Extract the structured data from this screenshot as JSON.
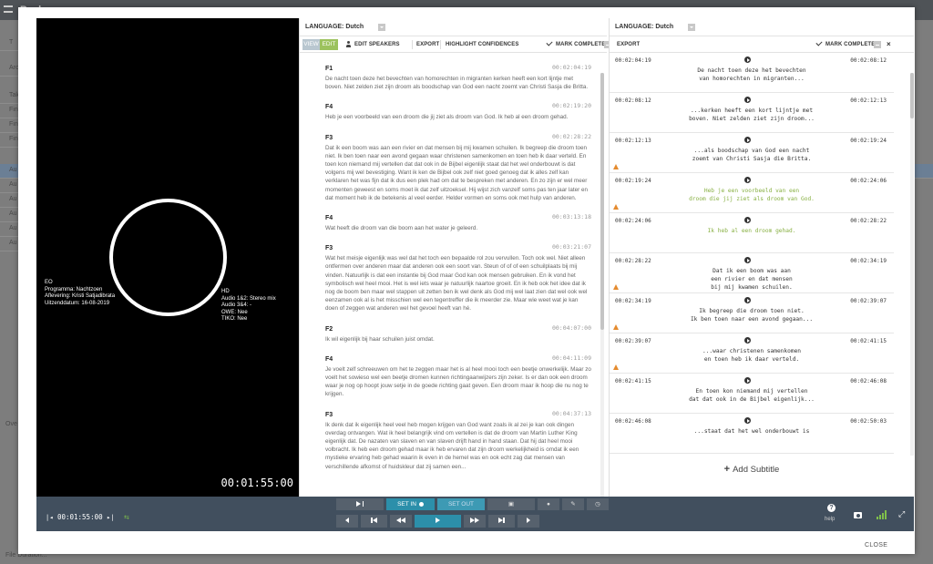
{
  "background": {
    "title": "Back",
    "rows": [
      "T",
      "Arc",
      "Tak",
      "Fin",
      "Fin",
      "Fin",
      "Au",
      "Au",
      "Au",
      "Au",
      "Au",
      "Au"
    ],
    "bottom_text": [
      "Ove",
      "File Duration..."
    ]
  },
  "editor": {
    "language_label": "LANGUAGE: Dutch",
    "view_label": "VIEW",
    "edit_label": "EDIT",
    "edit_speakers_label": "EDIT SPEAKERS",
    "export_label": "EXPORT",
    "highlight_label": "HIGHLIGHT CONFIDENCES",
    "mark_complete_label": "MARK COMPLETE",
    "close_label": "×",
    "segments": [
      {
        "speaker": "F1",
        "time": "00:02:04:19",
        "text": "De nacht toen deze het bevechten van homorechten in migranten kerken heeft een kort lijntje met boven. Niet zelden ziet zijn droom als boodschap van God een nacht zoemt van Christi Sasja die Britta."
      },
      {
        "speaker": "F4",
        "time": "00:02:19:20",
        "text": "Heb je een voorbeeld van een droom die jij ziet als droom van God. Ik heb al een droom gehad."
      },
      {
        "speaker": "F3",
        "time": "00:02:28:22",
        "text": "Dat ik een boom was aan een rivier en dat mensen bij mij kwamen schuilen. Ik begreep die droom toen niet. Ik ben toen naar een avond gegaan waar christenen samenkomen en toen heb ik daar verteld. En toen kon niemand mij vertellen dat dat ook in de Bijbel eigenlijk staat dat het wel onderbouwt is dat volgens mij wel bevestiging. Want ik ken de Bijbel ook zelf niet goed genoeg dat ik alles zelf kan verklaren het was fijn dat ik dus een plek had om dat te bespreken met anderen. En zo zijn er wel meer momenten geweest en soms moet ik dat zelf uitzoeksel. Hij wijst zich vanzelf soms pas ten jaar later en dat moment heb ik de betekenis al veel eerder. Helder vormen en soms ook met hulp van anderen."
      },
      {
        "speaker": "F4",
        "time": "00:03:13:18",
        "text": "Wat heeft die droom van die boom aan het water je geleerd."
      },
      {
        "speaker": "F3",
        "time": "00:03:21:07",
        "text": "Wat het meisje eigenlijk was wel dat het toch een bepaalde rol zou vervullen. Toch ook wel. Niet alleen ontfermen over anderen maar dat anderen ook een soort van. Steun of of of een schuilplaats bij mij vinden. Natuurlijk is dat een instantie bij God maar God kan ook mensen gebruiken. En ik vond het symbolisch wel heel mooi. Het is wel iets waar je natuurlijk naartoe groeit. En ik heb ook het idee dat ik nog de boom ben maar wel stappen uit zetten ben ik wel denk als God mij wel laat zien dat wel ook wel eenzamen ook al is het misschien wel een tegentreffer die ik meerder zie. Maar wie weet wat je kan doen of zeggen wat anderen wel het gevoel heeft van hé."
      },
      {
        "speaker": "F2",
        "time": "00:04:07:00",
        "text": "Ik wil eigenlijk bij haar schuilen juist omdat."
      },
      {
        "speaker": "F4",
        "time": "00:04:11:09",
        "text": "Je voelt zelf schreeuwen om het te zeggen maar het is al heel mooi toch een beetje onwerkelijk. Maar zo voelt het sowieso wel een beetje dromen kunnen richtingaanwijzers zijn zeker. Is er dan ook een droom waar je nog op hoopt jouw setje in de goede richting gaat geven. Een droom maar ik hoop die nu nog te krijgen."
      },
      {
        "speaker": "F3",
        "time": "00:04:37:13",
        "text": "Ik denk dat ik eigenlijk heel veel heb mogen krijgen van God want zoals ik al zei je kan ook dingen overdag ontvangen. Wat ik heel belangrijk vind om vertellen is dat de droom van Martin Luther King eigenlijk dat. De nazaten van slaven en van slaven drijft hand in hand staan. Dat hij dat heel mooi volbracht. Ik heb een droom gehad maar ik heb ervaren dat zijn droom werkelijkheid is omdat ik een mystieke ervaring heb gehad waarin ik even in de hemel was en ook echt zag dat mensen van verschillende afkomst of huidskleur dat zij samen een..."
      }
    ]
  },
  "subtitles": {
    "language_label": "LANGUAGE: Dutch",
    "export_label": "EXPORT",
    "mark_complete_label": "MARK COMPLETE",
    "close_label": "×",
    "add_label": "Add Subtitle",
    "items": [
      {
        "in": "00:02:04:19",
        "out": "00:02:08:12",
        "text": "De nacht toen deze het bevechten\nvan homorechten in migranten...",
        "green": false,
        "warn": false
      },
      {
        "in": "00:02:08:12",
        "out": "00:02:12:13",
        "text": "...kerken heeft een kort lijntje met\nboven. Niet zelden ziet zijn droom...",
        "green": false,
        "warn": false
      },
      {
        "in": "00:02:12:13",
        "out": "00:02:19:24",
        "text": "...als boodschap van God een nacht\nzoemt van Christi Sasja die Britta.",
        "green": false,
        "warn": true
      },
      {
        "in": "00:02:19:24",
        "out": "00:02:24:06",
        "text": "Heb je een voorbeeld van een\ndroom die jij ziet als droom van God.",
        "green": true,
        "warn": true
      },
      {
        "in": "00:02:24:06",
        "out": "00:02:28:22",
        "text": "Ik heb al een droom gehad.",
        "green": true,
        "warn": false
      },
      {
        "in": "00:02:28:22",
        "out": "00:02:34:19",
        "text": "Dat ik een boom was aan\neen rivier en dat mensen\nbij mij kwamen schuilen.",
        "green": false,
        "warn": true
      },
      {
        "in": "00:02:34:19",
        "out": "00:02:39:07",
        "text": "Ik begreep die droom toen niet.\nIk ben toen naar een avond gegaan...",
        "green": false,
        "warn": true
      },
      {
        "in": "00:02:39:07",
        "out": "00:02:41:15",
        "text": "...waar christenen samenkomen\nen toen heb ik daar verteld.",
        "green": false,
        "warn": true
      },
      {
        "in": "00:02:41:15",
        "out": "00:02:46:08",
        "text": "En toen kon niemand mij vertellen\ndat dat ook in de Bijbel eigenlijk...",
        "green": false,
        "warn": false
      },
      {
        "in": "00:02:46:08",
        "out": "00:02:50:03",
        "text": "...staat dat het wel onderbouwt is",
        "green": false,
        "warn": false
      }
    ]
  },
  "video": {
    "timecode": "00:01:55:00",
    "osd_left": [
      "EO",
      "Programma: Nachtzoen",
      "Aflevering: Kristi Satjadibrata",
      "Uitzenddatum: 16-08-2019"
    ],
    "osd_right": [
      "HD",
      "Audio 1&2: Stereo mix",
      "Audio 3&4: -",
      "OWE: Nee",
      "TIKO: Nee"
    ]
  },
  "controls": {
    "timecode": "00:01:55:00",
    "set_in_label": "SET IN",
    "set_out_label": "SET OUT",
    "help_label": "help"
  },
  "footer": {
    "close_label": "CLOSE"
  }
}
